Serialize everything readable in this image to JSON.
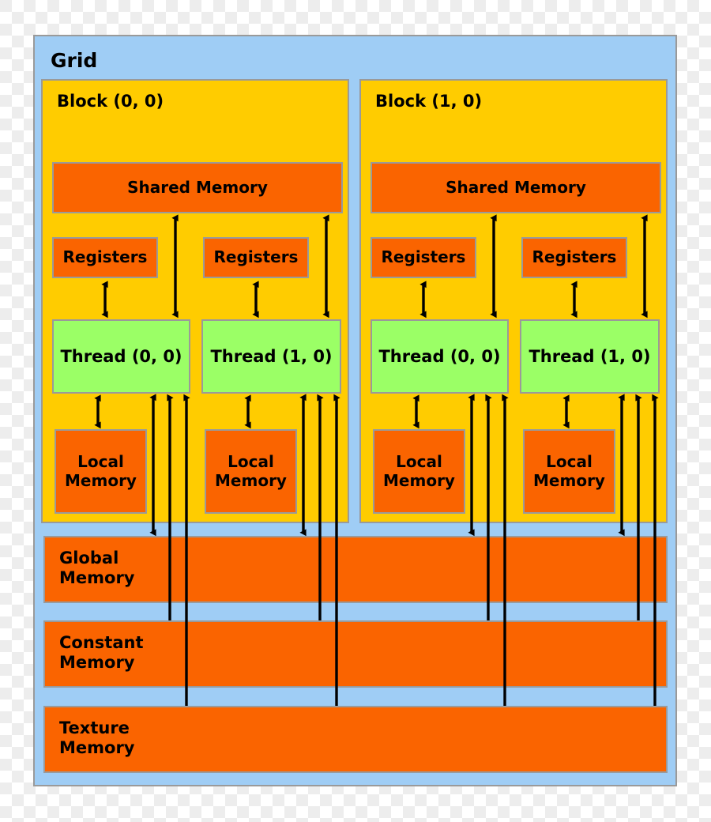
{
  "diagram": {
    "title": "Grid",
    "grid_label": "Grid",
    "colors": {
      "grid_bg": "#9fcdf5",
      "block_bg": "#ffcc00",
      "memory_bg": "#fa6400",
      "thread_bg": "#9bff66",
      "border": "#9a9a9a",
      "arrow": "#000000",
      "text": "#000000"
    },
    "blocks": [
      {
        "label": "Block (0, 0)",
        "shared_memory": "Shared Memory",
        "lanes": [
          {
            "registers": "Registers",
            "thread": "Thread (0, 0)",
            "local_memory": "Local\nMemory"
          },
          {
            "registers": "Registers",
            "thread": "Thread (1, 0)",
            "local_memory": "Local\nMemory"
          }
        ]
      },
      {
        "label": "Block (1, 0)",
        "shared_memory": "Shared Memory",
        "lanes": [
          {
            "registers": "Registers",
            "thread": "Thread (0, 0)",
            "local_memory": "Local\nMemory"
          },
          {
            "registers": "Registers",
            "thread": "Thread (1, 0)",
            "local_memory": "Local\nMemory"
          }
        ]
      }
    ],
    "global_memories": [
      {
        "name": "global-memory",
        "label": "Global\nMemory"
      },
      {
        "name": "constant-memory",
        "label": "Constant\nMemory"
      },
      {
        "name": "texture-memory",
        "label": "Texture\nMemory"
      }
    ]
  }
}
